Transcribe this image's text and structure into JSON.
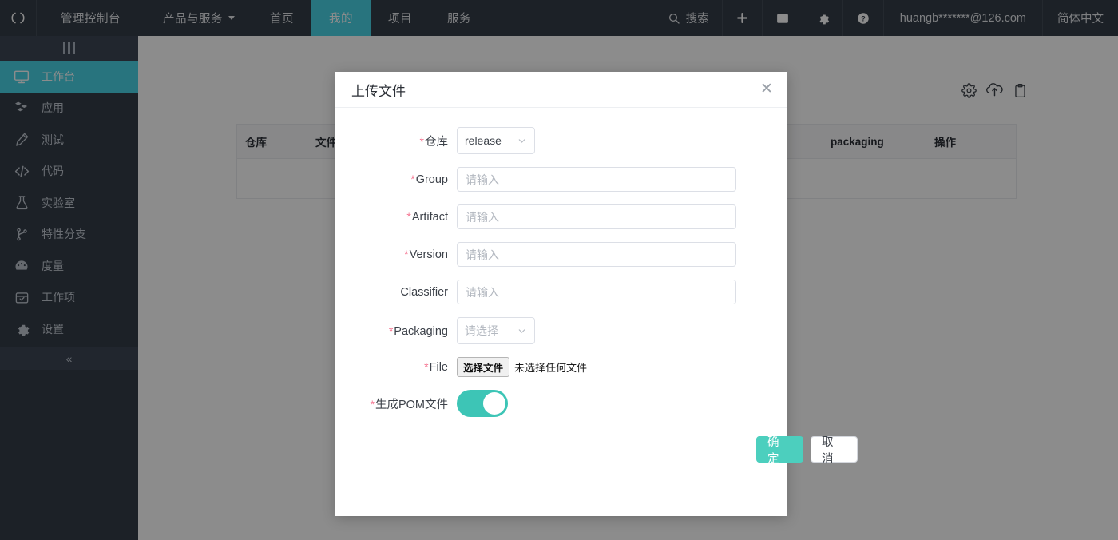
{
  "header": {
    "logo_icon": "cycle-logo-icon",
    "nav": [
      {
        "label": "管理控制台",
        "active": false,
        "caret": false
      },
      {
        "label": "产品与服务",
        "active": false,
        "caret": true
      },
      {
        "label": "首页",
        "active": false,
        "caret": false
      },
      {
        "label": "我的",
        "active": true,
        "caret": false
      },
      {
        "label": "项目",
        "active": false,
        "caret": false
      },
      {
        "label": "服务",
        "active": false,
        "caret": false
      }
    ],
    "search_label": "搜索",
    "search_icon": "search-icon",
    "add_icon": "plus-icon",
    "inbox_icon": "inbox-icon",
    "settings_icon": "gear-icon",
    "help_icon": "question-circle-icon",
    "user": "huangb*******@126.com",
    "language": "简体中文"
  },
  "sidebar": {
    "logo_icon": "bars-logo-icon",
    "collapse_icon": "double-chevron-left-icon",
    "items": [
      {
        "label": "工作台",
        "icon": "monitor-icon",
        "active": true
      },
      {
        "label": "应用",
        "icon": "cubes-icon",
        "active": false
      },
      {
        "label": "测试",
        "icon": "pen-icon",
        "active": false
      },
      {
        "label": "代码",
        "icon": "code-icon",
        "active": false
      },
      {
        "label": "实验室",
        "icon": "flask-icon",
        "active": false
      },
      {
        "label": "特性分支",
        "icon": "branch-icon",
        "active": false
      },
      {
        "label": "度量",
        "icon": "gauge-icon",
        "active": false
      },
      {
        "label": "工作项",
        "icon": "task-box-icon",
        "active": false
      },
      {
        "label": "设置",
        "icon": "gear-icon",
        "active": false
      }
    ]
  },
  "page": {
    "toolbar_icons": [
      {
        "name": "settings-gear-icon"
      },
      {
        "name": "upload-icon"
      },
      {
        "name": "clipboard-icon"
      }
    ],
    "table": {
      "columns": [
        "仓库",
        "文件名",
        "",
        "packaging",
        "操作"
      ]
    }
  },
  "modal": {
    "title": "上传文件",
    "close_icon": "close-icon",
    "fields": {
      "repo": {
        "label": "仓库",
        "required": true,
        "value": "release",
        "chevron_icon": "chevron-down-icon"
      },
      "group": {
        "label": "Group",
        "required": true,
        "placeholder": "请输入",
        "value": ""
      },
      "artifact": {
        "label": "Artifact",
        "required": true,
        "placeholder": "请输入",
        "value": ""
      },
      "version": {
        "label": "Version",
        "required": true,
        "placeholder": "请输入",
        "value": ""
      },
      "classifier": {
        "label": "Classifier",
        "required": false,
        "placeholder": "请输入",
        "value": ""
      },
      "packaging": {
        "label": "Packaging",
        "required": true,
        "placeholder": "请选择",
        "chevron_icon": "chevron-down-icon"
      },
      "file": {
        "label": "File",
        "required": true,
        "button_label": "选择文件",
        "status_text": "未选择任何文件"
      },
      "gen_pom": {
        "label": "生成POM文件",
        "required": true,
        "toggle_on": true
      }
    },
    "confirm_label": "确 定",
    "cancel_label": "取 消"
  },
  "colors": {
    "header_bg": "#333c47",
    "accent_cyan": "#4ad4e6",
    "accent_teal": "#4ccfbe",
    "required_red": "#f5728f"
  }
}
